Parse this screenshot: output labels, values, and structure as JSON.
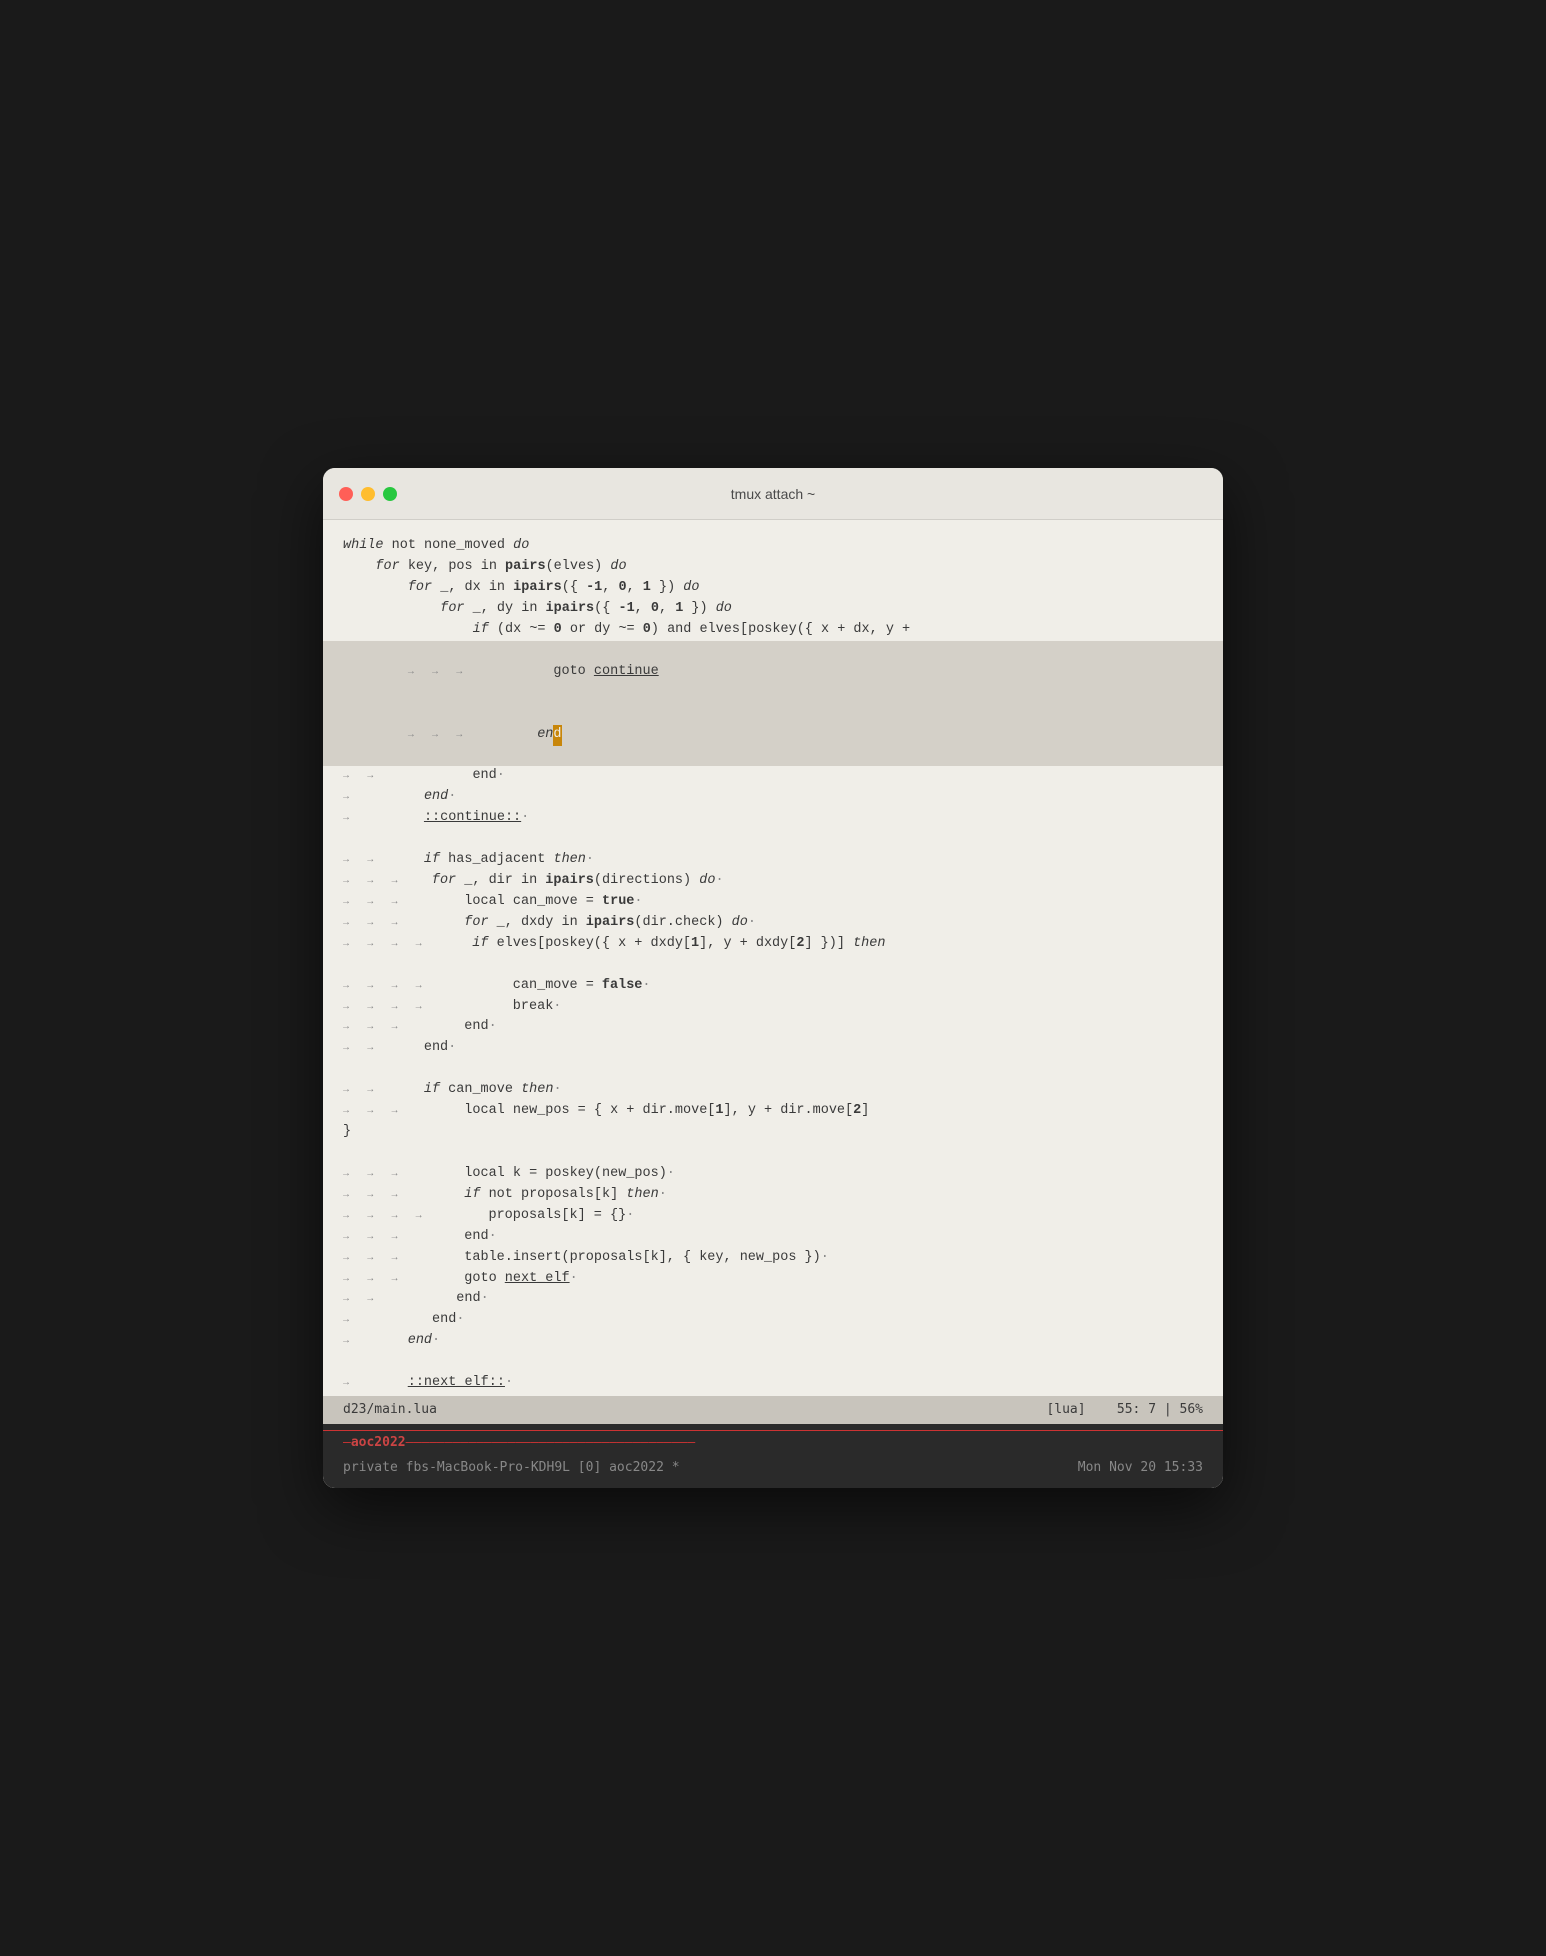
{
  "window": {
    "title": "tmux attach ~",
    "traffic_lights": {
      "close": "close",
      "minimize": "minimize",
      "maximize": "maximize"
    }
  },
  "status_bar": {
    "filename": "d23/main.lua",
    "filetype": "[lua]",
    "position": "55: 7 | 56%"
  },
  "tmux": {
    "separator_label": "aoc2022",
    "session_info_left": "private fbs-MacBook-Pro-KDH9L [0] aoc2022 *",
    "session_info_right": "Mon Nov 20 15:33"
  }
}
